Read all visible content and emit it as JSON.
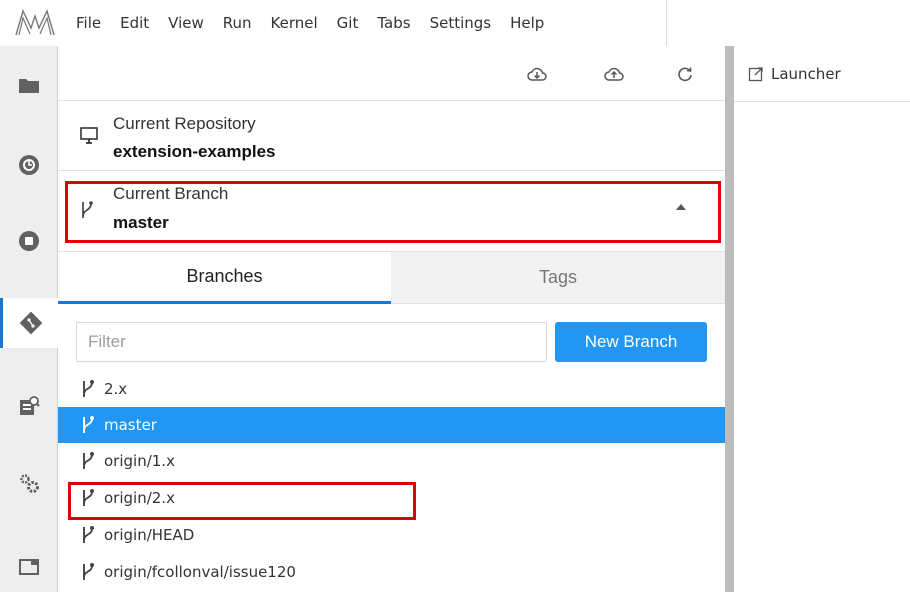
{
  "menu": [
    "File",
    "Edit",
    "View",
    "Run",
    "Kernel",
    "Git",
    "Tabs",
    "Settings",
    "Help"
  ],
  "activity": [
    "folder-icon",
    "running-icon",
    "stop-icon",
    "git-icon",
    "property-inspector-icon",
    "extension-manager-icon",
    "tabs-icon"
  ],
  "repository": {
    "label": "Current Repository",
    "name": "extension-examples"
  },
  "current_branch": {
    "label": "Current Branch",
    "name": "master"
  },
  "tabs": {
    "branches": "Branches",
    "tags": "Tags"
  },
  "filter": {
    "placeholder": "Filter"
  },
  "new_branch_label": "New Branch",
  "branches": [
    "2.x",
    "master",
    "origin/1.x",
    "origin/2.x",
    "origin/HEAD",
    "origin/fcollonval/issue120"
  ],
  "selected_branch": "master",
  "launcher": {
    "label": "Launcher"
  },
  "colors": {
    "accent": "#2196f3",
    "highlight": "#e00000"
  }
}
